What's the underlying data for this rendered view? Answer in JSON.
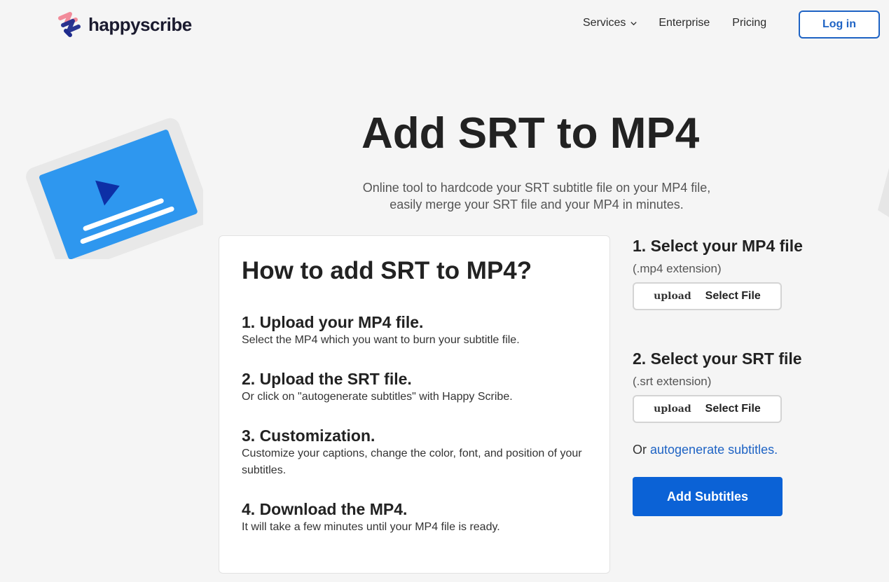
{
  "brand": {
    "name": "happyscribe"
  },
  "nav": {
    "services": "Services",
    "enterprise": "Enterprise",
    "pricing": "Pricing",
    "login": "Log in"
  },
  "hero": {
    "title": "Add SRT to MP4",
    "subtitle_line1": "Online tool to hardcode your SRT subtitle file on your MP4 file,",
    "subtitle_line2": "easily merge your SRT file and your MP4 in minutes."
  },
  "howto": {
    "title": "How to add SRT to MP4?",
    "steps": [
      {
        "title": "1. Upload your MP4 file.",
        "desc": "Select the MP4 which you want to burn your subtitle file."
      },
      {
        "title": "2. Upload the SRT file.",
        "desc": "Or click on \"autogenerate subtitles\" with Happy Scribe."
      },
      {
        "title": "3. Customization.",
        "desc": "Customize your captions, change the color, font, and position of your subtitles."
      },
      {
        "title": "4. Download the MP4.",
        "desc": "It will take a few minutes until your MP4 file is ready."
      }
    ]
  },
  "panel": {
    "mp4": {
      "title": "1.  Select your MP4 file",
      "ext": "(.mp4 extension)",
      "upload_word": "upload",
      "button": "Select File"
    },
    "srt": {
      "title": "2.  Select your SRT file",
      "ext": "(.srt extension)",
      "upload_word": "upload",
      "button": "Select File"
    },
    "or_text": "Or ",
    "autogen_link": "autogenerate subtitles.",
    "submit": "Add Subtitles"
  },
  "colors": {
    "accent": "#1e63c4",
    "primary_button": "#0b62d6",
    "illustration_blue": "#2e97ef",
    "illustration_dark": "#0d2fa6",
    "background": "#f5f5f5"
  }
}
